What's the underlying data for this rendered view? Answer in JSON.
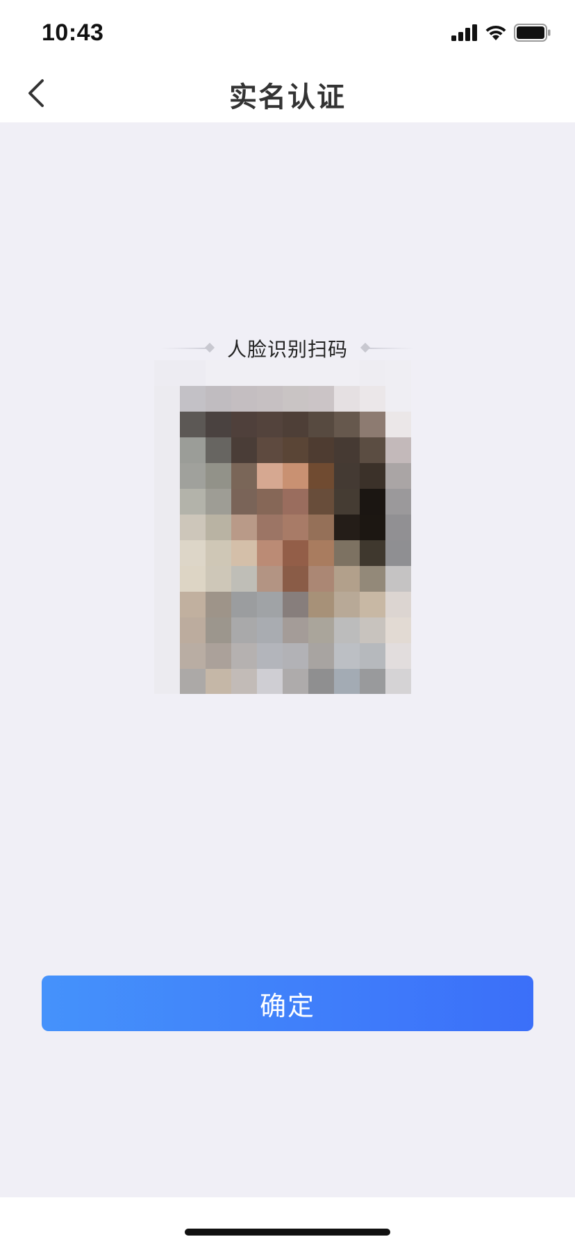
{
  "status_bar": {
    "time": "10:43",
    "icons": [
      "signal-icon",
      "wifi-icon",
      "battery-icon"
    ]
  },
  "nav": {
    "back_icon": "chevron-left-icon",
    "title": "实名认证"
  },
  "face": {
    "title": "人脸识别扫码",
    "image": "pixelated-face-photo"
  },
  "actions": {
    "confirm_label": "确定"
  },
  "colors": {
    "background": "#f0eff6",
    "primary_start": "#4592fb",
    "primary_end": "#3b6ff9"
  }
}
